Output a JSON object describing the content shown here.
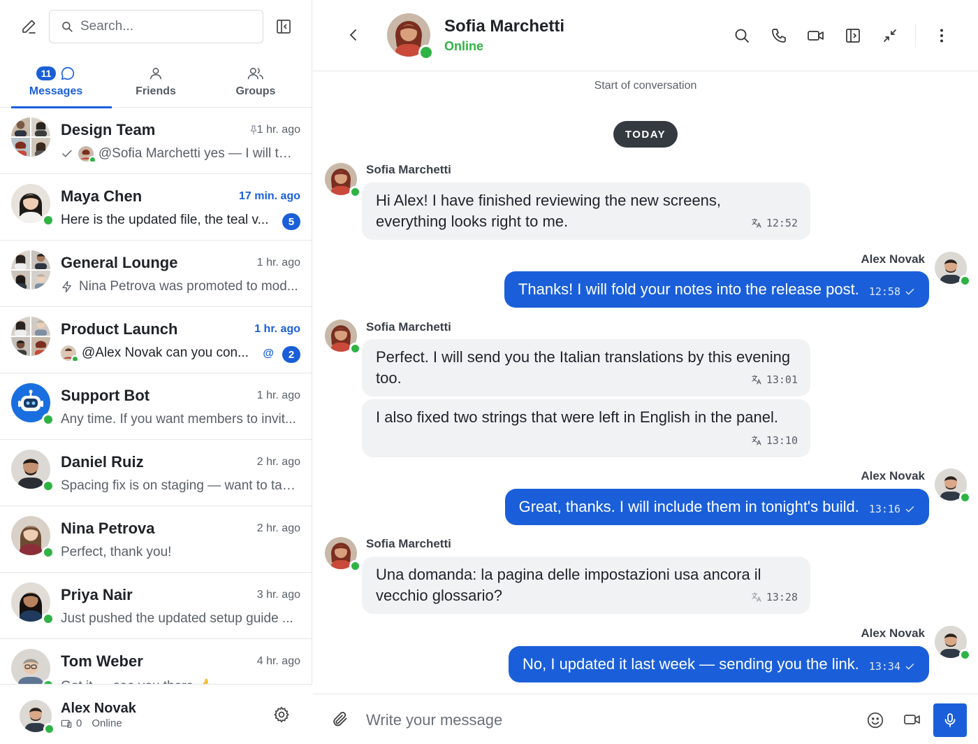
{
  "sidebar": {
    "search_placeholder": "Search...",
    "tabs": [
      {
        "label": "Messages",
        "badge": "11"
      },
      {
        "label": "Friends"
      },
      {
        "label": "Groups"
      }
    ],
    "conversations": [
      {
        "name": "Design Team",
        "time": "1 hr. ago",
        "preview": "@Sofia Marchetti yes — I will ta...",
        "pinned": true
      },
      {
        "name": "Maya Chen",
        "time": "17 min. ago",
        "preview": "Here is the updated file, the teal v...",
        "unread_count": "5"
      },
      {
        "name": "General Lounge",
        "time": "1 hr. ago",
        "preview": "Nina Petrova was promoted to mod..."
      },
      {
        "name": "Product Launch",
        "time": "1 hr. ago",
        "preview": "@Alex Novak can you con...",
        "mention": "@",
        "unread_count": "2"
      },
      {
        "name": "Support Bot",
        "time": "1 hr. ago",
        "preview": "Any time. If you want members to invit..."
      },
      {
        "name": "Daniel Ruiz",
        "time": "2 hr. ago",
        "preview": "Spacing fix is on staging — want to tak..."
      },
      {
        "name": "Nina Petrova",
        "time": "2 hr. ago",
        "preview": "Perfect, thank you!"
      },
      {
        "name": "Priya Nair",
        "time": "3 hr. ago",
        "preview": "Just pushed the updated setup guide ..."
      },
      {
        "name": "Tom Weber",
        "time": "4 hr. ago",
        "preview": "Got it — see you there 👍"
      }
    ],
    "me": {
      "name": "Alex Novak",
      "device_count": "0",
      "status": "Online"
    }
  },
  "chat": {
    "contact_name": "Sofia Marchetti",
    "contact_status": "Online",
    "start_label": "Start of conversation",
    "day_label": "TODAY",
    "composer_placeholder": "Write your message",
    "messages": [
      {
        "sender": "Sofia Marchetti",
        "text": "Hi Alex! I have finished reviewing the new screens, everything looks right to me.",
        "time": "12:52"
      },
      {
        "sender": "Alex Novak",
        "text": "Thanks! I will fold your notes into the release post.",
        "time": "12:58"
      },
      {
        "sender": "Sofia Marchetti",
        "text": "Perfect. I will send you the Italian translations by this evening too.",
        "time": "13:01"
      },
      {
        "sender": "Sofia Marchetti",
        "text": "I also fixed two strings that were left in English in the panel.",
        "time": "13:10"
      },
      {
        "sender": "Alex Novak",
        "text": "Great, thanks. I will include them in tonight's build.",
        "time": "13:16"
      },
      {
        "sender": "Sofia Marchetti",
        "text": "Una domanda: la pagina delle impostazioni usa ancora il vecchio glossario?",
        "time": "13:28"
      },
      {
        "sender": "Alex Novak",
        "text": "No, I updated it last week — sending you the link.",
        "time": "13:34"
      }
    ]
  },
  "colors": {
    "accent": "#1a5fd9",
    "online": "#2fb344",
    "pill": "#343a40",
    "incoming_bubble": "#f1f2f4"
  }
}
